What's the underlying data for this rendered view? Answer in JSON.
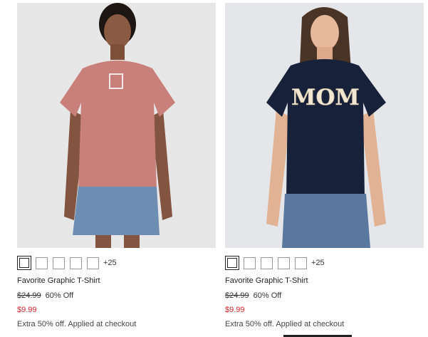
{
  "products": [
    {
      "name": "Favorite Graphic T-Shirt",
      "swatch_more": "+25",
      "original_price": "$24.99",
      "discount": "60% Off",
      "sale_price": "$9.99",
      "promo": "Extra 50% off. Applied at checkout",
      "image_graphic_text": "",
      "shirt_color": "#c9807a"
    },
    {
      "name": "Favorite Graphic T-Shirt",
      "swatch_more": "+25",
      "original_price": "$24.99",
      "discount": "60% Off",
      "sale_price": "$9.99",
      "promo": "Extra 50% off. Applied at checkout",
      "image_graphic_text": "MOM",
      "shirt_color": "#17223a"
    }
  ],
  "colors": {
    "sale": "#d1232a",
    "photo_bg": "#e6e6e6"
  }
}
